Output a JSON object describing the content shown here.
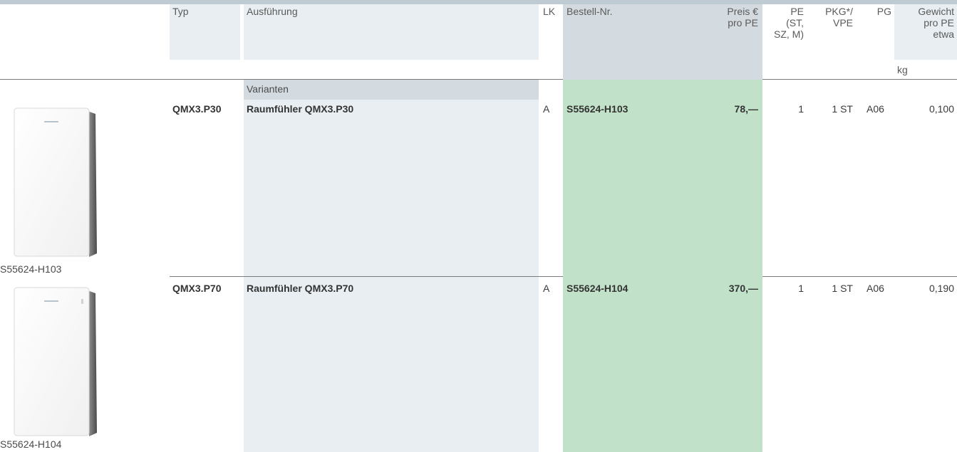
{
  "header": {
    "typ": "Typ",
    "ausfuehrung": "Ausführung",
    "lk": "LK",
    "bestell_nr": "Bestell-Nr.",
    "preis_line1": "Preis €",
    "preis_line2": "pro PE",
    "pe_line1": "PE",
    "pe_line2": "(ST,",
    "pe_line3": "SZ, M)",
    "pkg_line1": "PKG*/",
    "pkg_line2": "VPE",
    "pg": "PG",
    "gew_line1": "Gewicht",
    "gew_line2": "pro PE",
    "gew_line3": "etwa",
    "unit_kg": "kg"
  },
  "section_label": "Varianten",
  "products": [
    {
      "typ": "QMX3.P30",
      "ausfuehrung": "Raumfühler QMX3.P30",
      "lk": "A",
      "bestell_nr": "S55624-H103",
      "preis": "78,—",
      "pe": "1",
      "pkg": "1 ST",
      "pg": "A06",
      "gewicht": "0,100",
      "image_caption": "S55624-H103",
      "image_icon": "room-sensor-image"
    },
    {
      "typ": "QMX3.P70",
      "ausfuehrung": "Raumfühler QMX3.P70",
      "lk": "A",
      "bestell_nr": "S55624-H104",
      "preis": "370,—",
      "pe": "1",
      "pkg": "1 ST",
      "pg": "A06",
      "gewicht": "0,190",
      "image_caption": "S55624-H104",
      "image_icon": "room-sensor-image"
    }
  ],
  "colors": {
    "header_band": "#bfcbd3",
    "light_column": "#e8eef1",
    "gray_column": "#d4dbe0",
    "order_column": "#c1e2c9"
  }
}
